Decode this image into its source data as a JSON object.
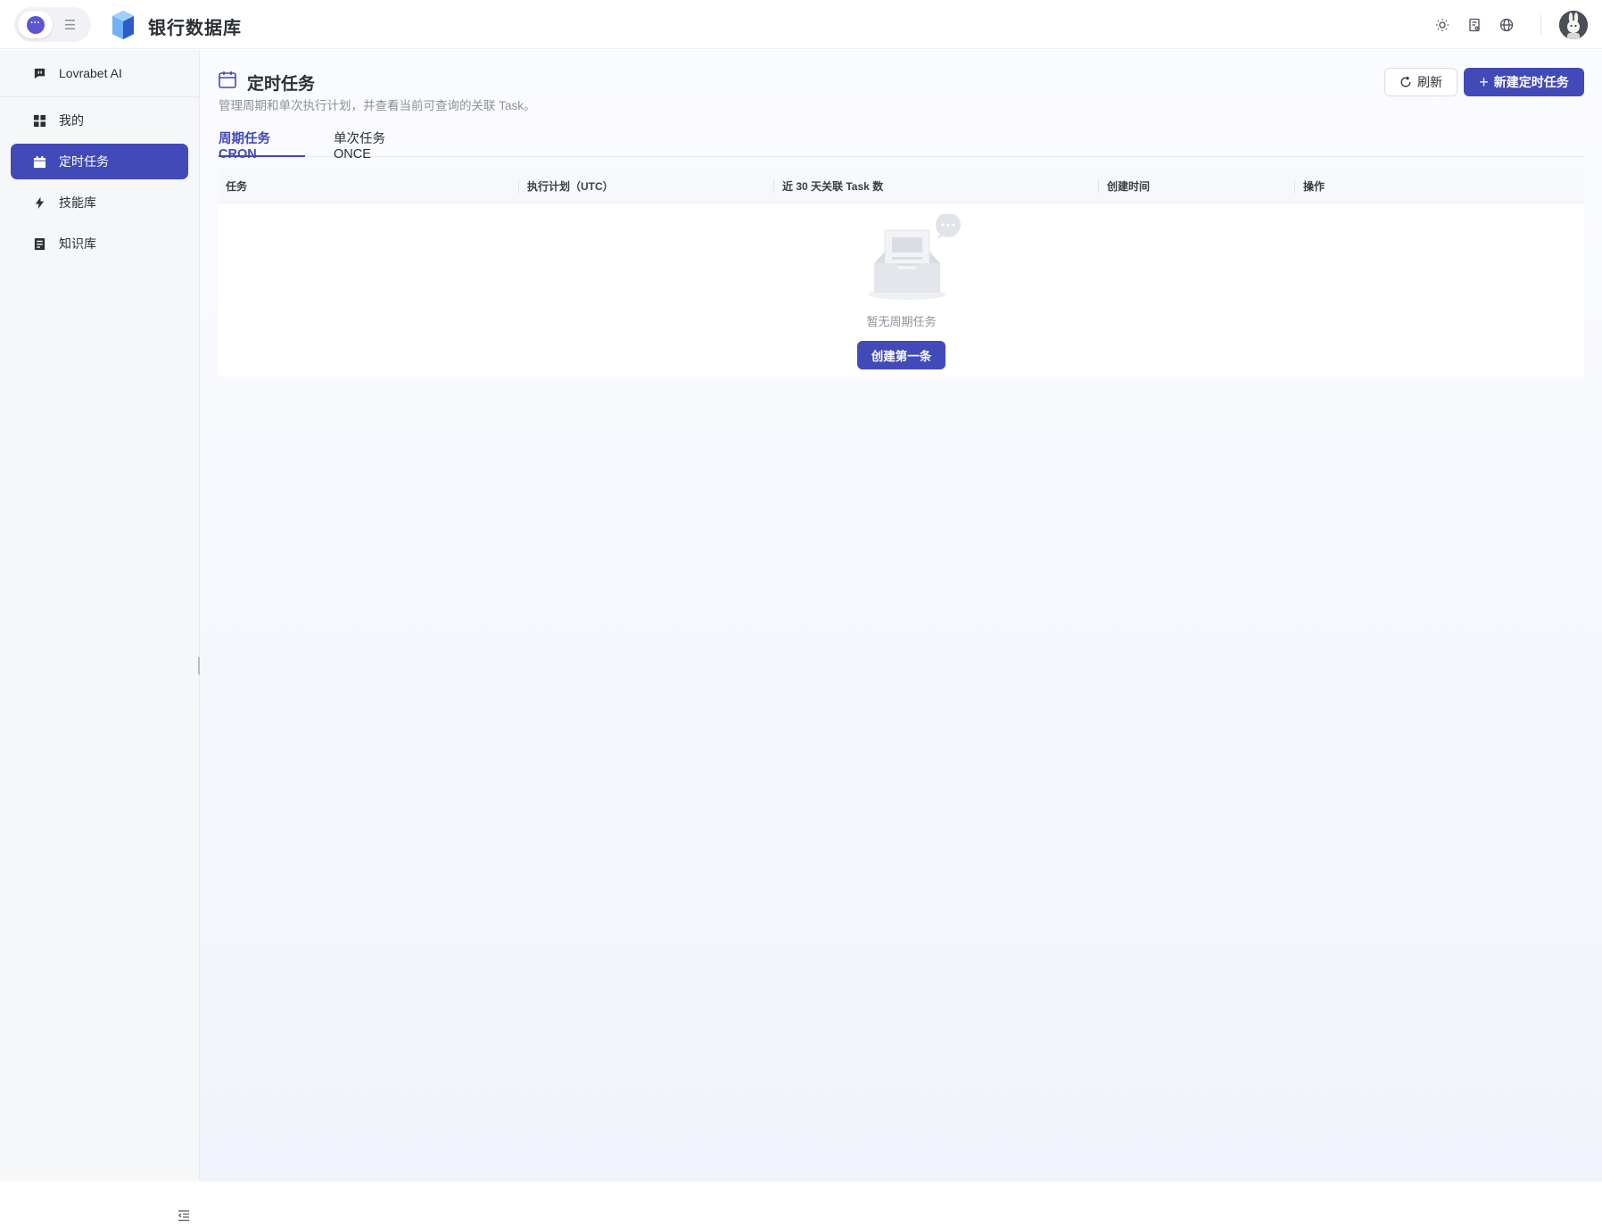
{
  "app": {
    "title": "银行数据库"
  },
  "topbar": {
    "mode_switch": {
      "chat_icon": "chat-bubble-icon",
      "list_icon": "list-icon",
      "active": "chat"
    },
    "icons": [
      "sun-icon",
      "document-icon",
      "globe-icon"
    ],
    "avatar": "user-avatar"
  },
  "sidebar": {
    "items": [
      {
        "label": "Lovrabet AI",
        "icon": "ai-chat-icon",
        "active": false
      },
      {
        "label": "我的",
        "icon": "grid-icon",
        "active": false
      },
      {
        "label": "定时任务",
        "icon": "calendar-icon",
        "active": true
      },
      {
        "label": "技能库",
        "icon": "lightning-icon",
        "active": false
      },
      {
        "label": "知识库",
        "icon": "book-icon",
        "active": false
      }
    ]
  },
  "page": {
    "title": "定时任务",
    "description": "管理周期和单次执行计划，并查看当前可查询的关联 Task。",
    "refresh_label": "刷新",
    "new_label": "新建定时任务"
  },
  "tabs": [
    {
      "label": "周期任务 CRON",
      "active": true
    },
    {
      "label": "单次任务 ONCE",
      "active": false
    }
  ],
  "table": {
    "columns": [
      "任务",
      "执行计划（UTC）",
      "近 30 天关联 Task 数",
      "创建时间",
      "操作"
    ],
    "rows": [],
    "empty_text": "暂无周期任务",
    "create_first_label": "创建第一条"
  },
  "colors": {
    "accent": "#4249b8",
    "chat_dot": "#5b55d6"
  }
}
